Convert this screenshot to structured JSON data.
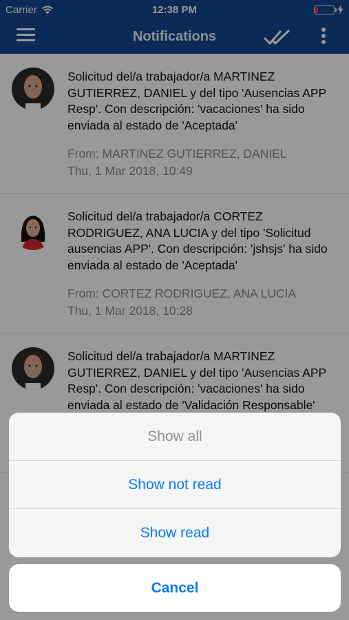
{
  "status_bar": {
    "carrier": "Carrier",
    "time": "12:38 PM",
    "battery_level": 0.15,
    "battery_color": "#ff3b30"
  },
  "nav": {
    "title": "Notifications",
    "menu_icon": "hamburger-icon",
    "mark_read_icon": "double-check-icon",
    "more_icon": "vertical-dots-icon",
    "background": "#13478f"
  },
  "notifications": [
    {
      "message": "Solicitud del/a trabajador/a MARTINEZ GUTIERREZ, DANIEL y del tipo 'Ausencias APP Resp'. Con descripción: 'vacaciones' ha sido enviada al estado de 'Aceptada'",
      "from": "From: MARTINEZ GUTIERREZ, DANIEL",
      "date": "Thu, 1 Mar 2018, 10:49"
    },
    {
      "message": "Solicitud del/a trabajador/a CORTEZ RODRIGUEZ, ANA LUCIA y del tipo 'Solicitud ausencias APP'. Con descripción: 'jshsjs' ha sido enviada al estado de 'Aceptada'",
      "from": "From: CORTEZ RODRIGUEZ, ANA LUCIA",
      "date": "Thu, 1 Mar 2018, 10:28"
    },
    {
      "message": "Solicitud del/a trabajador/a MARTINEZ GUTIERREZ, DANIEL y del tipo 'Ausencias APP Resp'. Con descripción: 'vacaciones' ha sido enviada al estado de 'Validación Responsable'",
      "from": "",
      "date": ""
    }
  ],
  "action_sheet": {
    "options": [
      "Show all",
      "Show not read",
      "Show read"
    ],
    "cancel": "Cancel",
    "accent": "#0a7bf4"
  }
}
